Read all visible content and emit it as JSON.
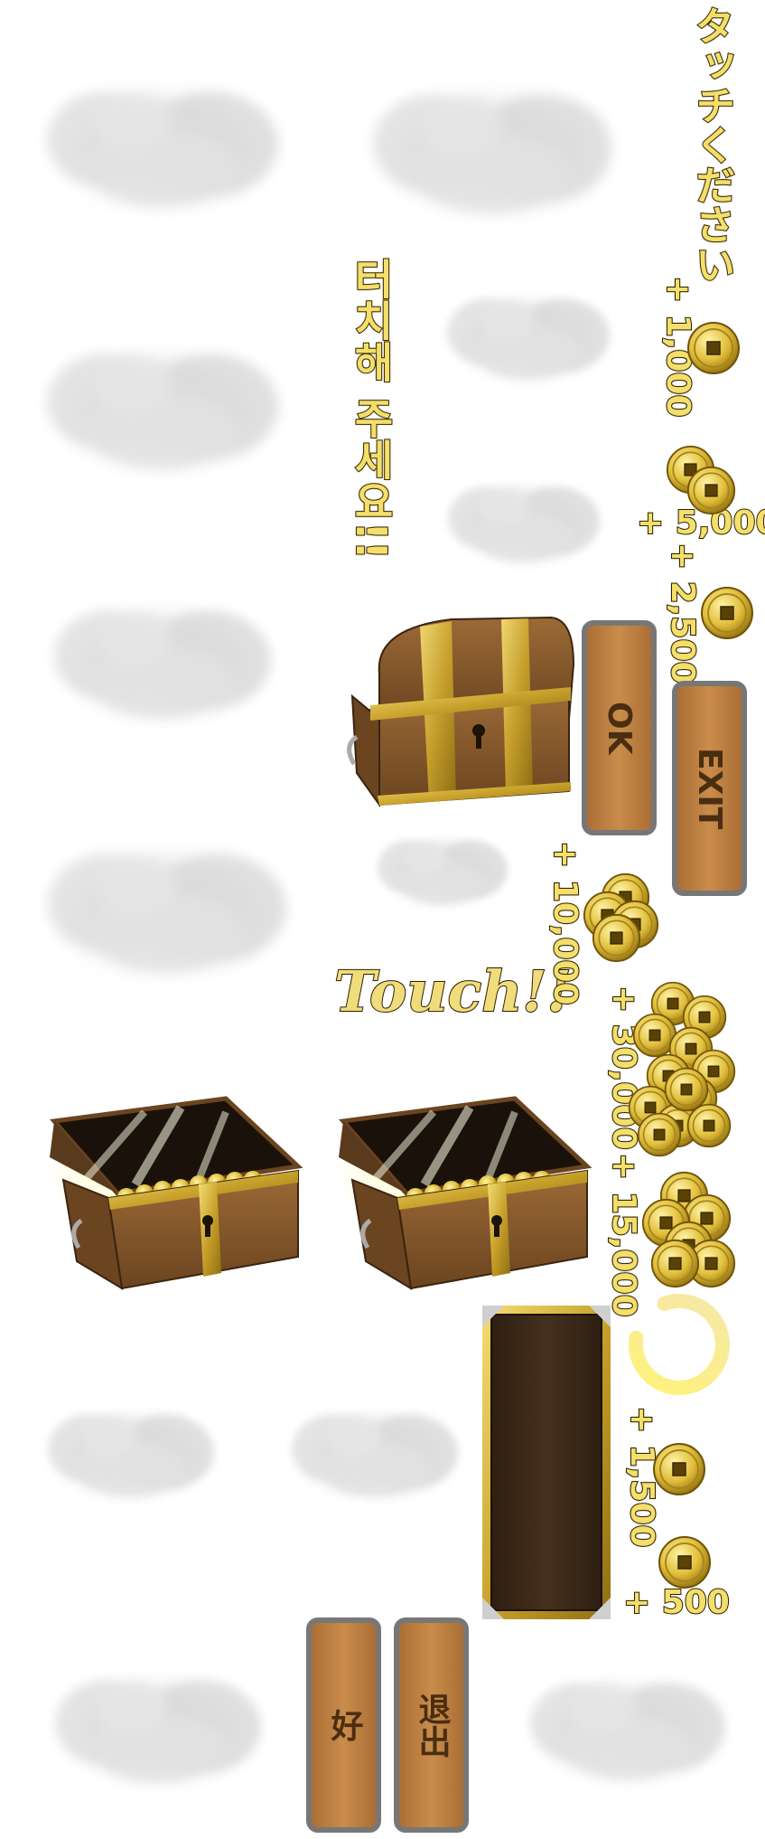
{
  "instructions": {
    "japanese": "タッチください",
    "korean": "터치해 주세요!!",
    "touch": "Touch!!"
  },
  "rewards": [
    {
      "id": "r1000",
      "label": "+ 1,000",
      "coins": 1
    },
    {
      "id": "r5000",
      "label": "+ 5,000",
      "coins": 2
    },
    {
      "id": "r2500",
      "label": "+ 2,500",
      "coins": 1
    },
    {
      "id": "r10000",
      "label": "+ 10,000",
      "coins": 4
    },
    {
      "id": "r30000",
      "label": "+ 30,000",
      "coins": 12
    },
    {
      "id": "r15000",
      "label": "+ 15,000",
      "coins": 6
    },
    {
      "id": "r1500",
      "label": "+ 1,500",
      "coins": 1
    },
    {
      "id": "r500",
      "label": "+ 500",
      "coins": 1
    }
  ],
  "buttons": {
    "ok": "OK",
    "exit": "EXIT",
    "ok_zh": "好",
    "exit_zh": "退出"
  },
  "colors": {
    "gold_text": "#f3df6a",
    "wood": "#b97a3e",
    "dark_wood": "#3a2716",
    "gold_trim": "#d8b83a"
  }
}
